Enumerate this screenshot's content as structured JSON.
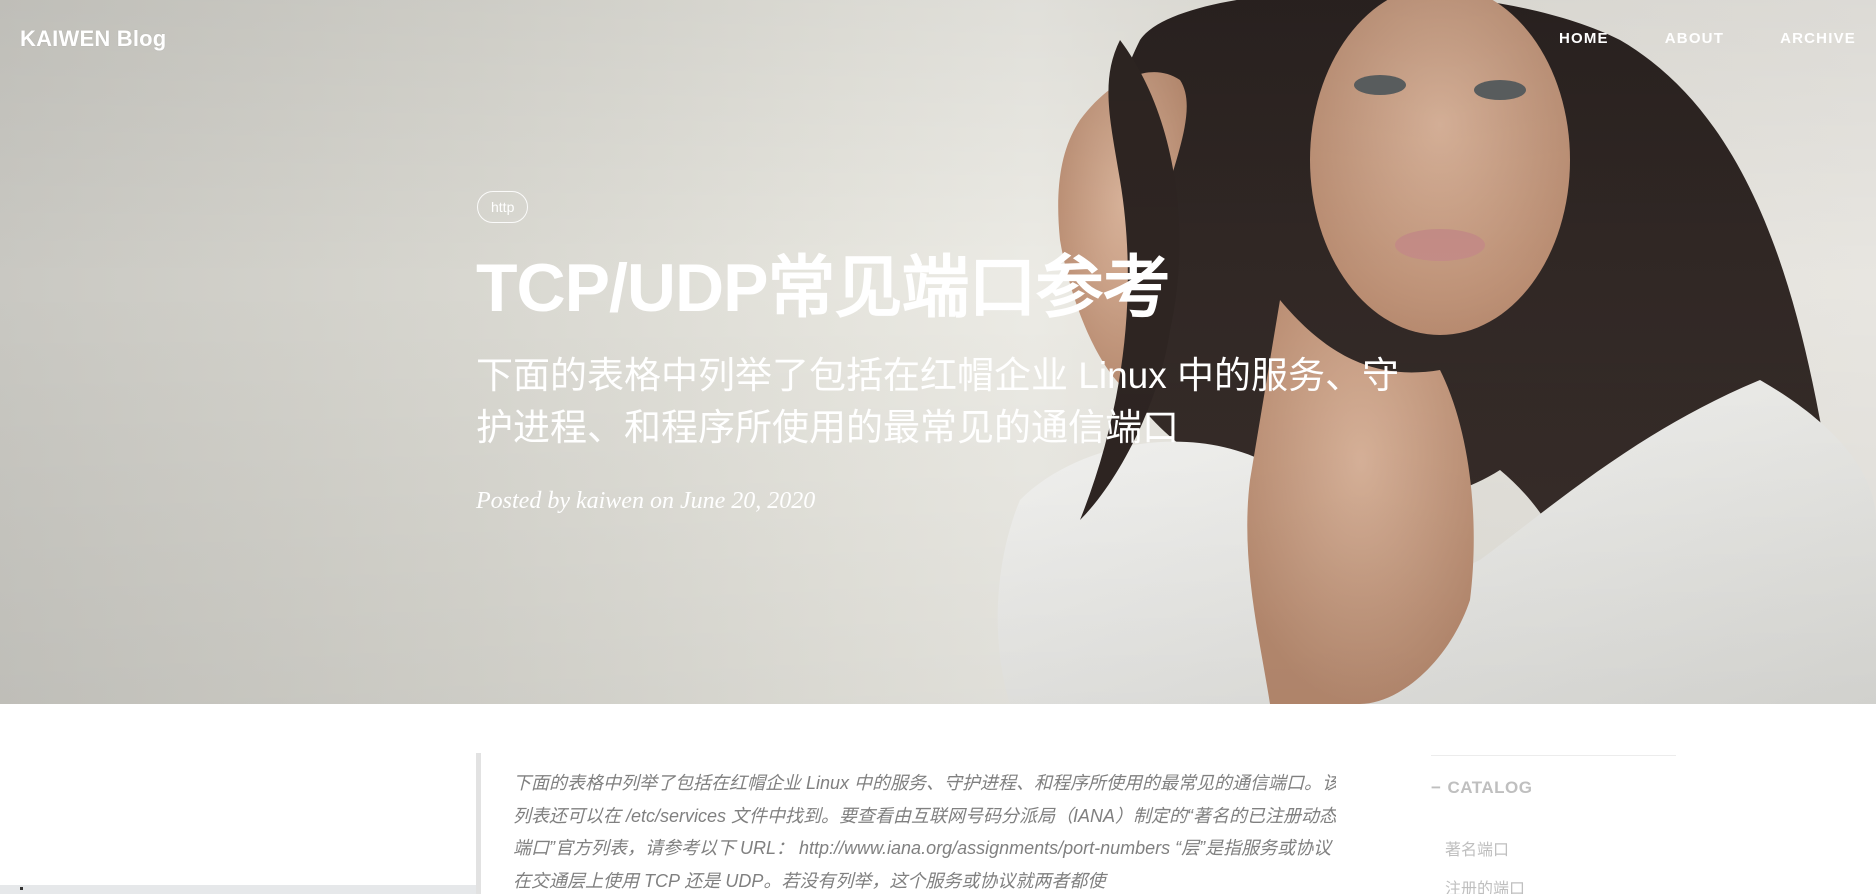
{
  "nav": {
    "brand": "KAIWEN Blog",
    "items": [
      {
        "label": "HOME"
      },
      {
        "label": "ABOUT"
      },
      {
        "label": "ARCHIVE"
      }
    ]
  },
  "post": {
    "tag": "http",
    "title": "TCP/UDP常见端口参考",
    "subtitle": "下面的表格中列举了包括在红帽企业 Linux 中的服务、守护进程、和程序所使用的最常见的通信端口",
    "meta": "Posted by kaiwen on June 20, 2020"
  },
  "content": {
    "blockquote": "下面的表格中列举了包括在红帽企业 Linux 中的服务、守护进程、和程序所使用的最常见的通信端口。该列表还可以在 /etc/services 文件中找到。要查看由互联网号码分派局（IANA）制定的“著名的已注册动态端口”官方列表，请参考以下 URL：  http://www.iana.org/assignments/port-numbers “层”是指服务或协议在交通层上使用 TCP 还是 UDP。若没有列举，这个服务或协议就两者都使"
  },
  "catalog": {
    "heading": "CATALOG",
    "items": [
      {
        "label": "著名端口"
      },
      {
        "label": "注册的端口"
      }
    ]
  },
  "colors": {
    "hero_bg": "#e6e5de",
    "nav_text": "#ffffff",
    "quote_text": "#808080",
    "catalog_text": "#bfbfbf"
  }
}
